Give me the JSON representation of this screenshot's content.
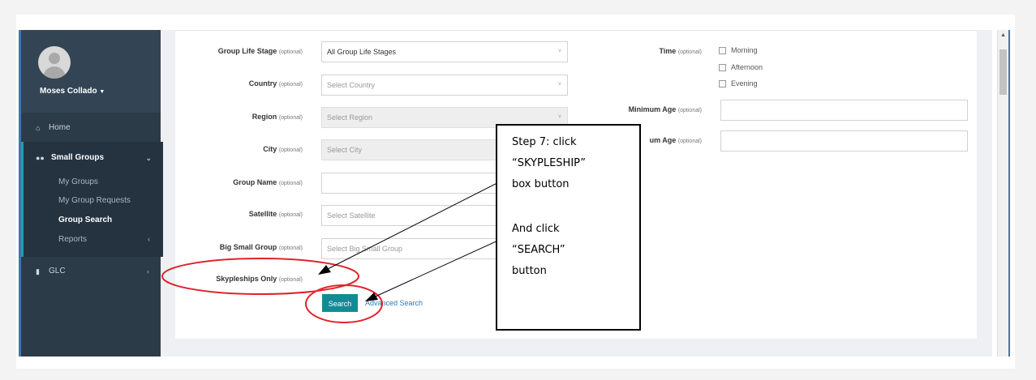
{
  "user": {
    "name": "Moses Collado"
  },
  "sidebar": {
    "items": [
      {
        "label": "Home",
        "icon": "home-icon"
      },
      {
        "label": "Small Groups",
        "icon": "users-icon"
      },
      {
        "label": "GLC",
        "icon": "book-icon"
      }
    ],
    "submenu": [
      "My Groups",
      "My Group Requests",
      "Group Search",
      "Reports"
    ],
    "active_submenu": "Group Search"
  },
  "form": {
    "optional_tag": "(optional)",
    "fields": [
      {
        "label": "Group Life Stage",
        "value": "All Group Life Stages"
      },
      {
        "label": "Country",
        "placeholder": "Select Country"
      },
      {
        "label": "Region",
        "placeholder": "Select Region"
      },
      {
        "label": "City",
        "placeholder": "Select City"
      },
      {
        "label": "Group Name"
      },
      {
        "label": "Satellite",
        "placeholder": "Select Satellite"
      },
      {
        "label": "Big Small Group",
        "placeholder": "Select Big Small Group"
      },
      {
        "label": "Skypleships Only"
      }
    ],
    "time": {
      "label": "Time",
      "options": [
        "Morning",
        "Afternoon",
        "Evening"
      ]
    },
    "min_age": {
      "label": "Minimum Age"
    },
    "max_age": {
      "label": "Maximum Age",
      "visible_label": "um Age"
    },
    "search_button": "Search",
    "advanced_link": "Advanced Search"
  },
  "annotation": {
    "lines": [
      "Step 7: click",
      "“SKYPLESHIP”",
      "box button",
      "And click",
      "“SEARCH”",
      "button"
    ],
    "color_circle": "#e0242b"
  }
}
